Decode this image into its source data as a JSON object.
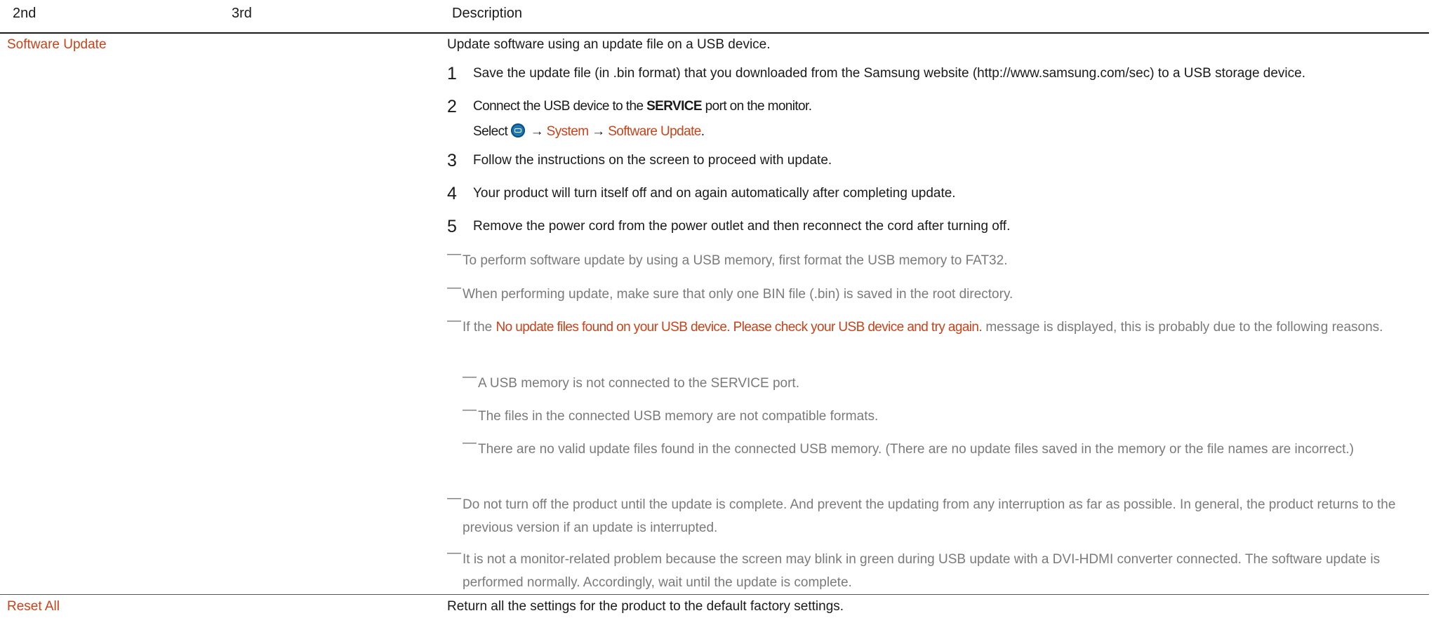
{
  "header": {
    "col2": "2nd",
    "col3": "3rd",
    "col_desc": "Description"
  },
  "software_update": {
    "name": "Software Update",
    "intro": "Update software using an update file on a USB device.",
    "steps": [
      {
        "num": "1",
        "text": "Save the update file (in .bin format) that you downloaded from the Samsung website (http://www.samsung.com/sec) to a USB storage device."
      },
      {
        "num": "2",
        "line1_pre": "Connect the USB device to the ",
        "line1_bold": "SERVICE",
        "line1_post": " port on the monitor.",
        "line2_pre": "Select ",
        "menu_icon": "menu-icon",
        "arrow": "→",
        "menu_system": "System",
        "menu_update": "Software Update",
        "line2_end": "."
      },
      {
        "num": "3",
        "text": "Follow the instructions on the screen to proceed with update."
      },
      {
        "num": "4",
        "text": "Your product will turn itself off and on again automatically after completing update."
      },
      {
        "num": "5",
        "text": "Remove the power cord from the power outlet and then reconnect the cord after turning off."
      }
    ],
    "notes": {
      "dash": "―",
      "n1": "To perform software update by using a USB memory, first format the USB memory to FAT32.",
      "n2": "When performing update, make sure that only one BIN file (.bin) is saved in the root directory.",
      "n3_pre": "If the ",
      "n3_red": "No update files found on your USB device. Please check your USB device and try again.",
      "n3_post": " message is displayed, this is probably due to the following reasons.",
      "s1_pre": "A USB memory is not connected to the ",
      "s1_bold": "SERVICE",
      "s1_post": " port.",
      "s2": "The files in the connected USB memory are not compatible formats.",
      "s3": "There are no valid update files found in the connected USB memory. (There are no update files saved in the memory or the file names are incorrect.)",
      "n4": "Do not turn off the product until the update is complete. And prevent the updating from any interruption as far as possible. In general, the product returns to the previous version if an update is interrupted.",
      "n5": "It is not a monitor-related problem because the screen may blink in green during USB update with a DVI-HDMI converter connected. The software update is performed normally. Accordingly, wait until the update is complete."
    }
  },
  "reset_all": {
    "name": "Reset All",
    "desc": "Return all the settings for the product to the default factory settings."
  },
  "colors": {
    "accent": "#c8421a",
    "note": "#7a7a7a",
    "menu_icon": "#1f78b4"
  }
}
